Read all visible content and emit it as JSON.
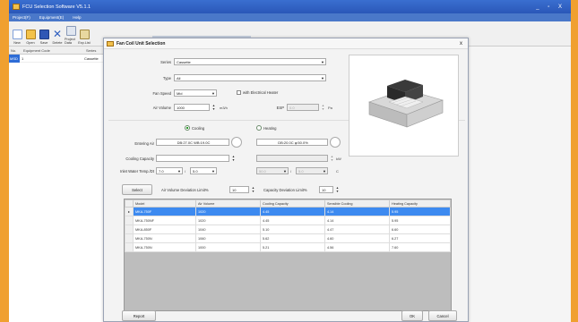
{
  "window": {
    "title": "FCU Selection Software V5.1.1",
    "controls": "_ ▫ X"
  },
  "menu": [
    "Project(F)",
    "Equipment(E)",
    "Help"
  ],
  "toolbar": [
    {
      "label": "New",
      "icon": "new-icon"
    },
    {
      "label": "Open",
      "icon": "open-icon"
    },
    {
      "label": "Save",
      "icon": "save-icon"
    },
    {
      "label": "Delete",
      "icon": "delete-icon"
    },
    {
      "label": "Project Data",
      "icon": "project-data-icon"
    },
    {
      "label": "Exp.List",
      "icon": "exp-list-icon"
    }
  ],
  "left_grid": {
    "columns": [
      "No.",
      "Equipment Code",
      "Series"
    ],
    "rows": [
      {
        "tag": "MSD",
        "no": "1",
        "series": "Cassette"
      }
    ]
  },
  "dialog": {
    "title": "Fan Coil Unit Selection",
    "close": "x",
    "series": {
      "label": "Series",
      "value": "Cassette"
    },
    "type": {
      "label": "Type",
      "value": "All"
    },
    "fan_speed": {
      "label": "Fan Speed",
      "value": "Mid"
    },
    "electrical_heater": "with Electrical Heater",
    "air_volume": {
      "label": "Air Volume",
      "value": "1000",
      "unit": "m3/h"
    },
    "esp": {
      "label": "ESP",
      "value": "0.0",
      "unit": "Pa"
    },
    "cooling_radio": "Cooling",
    "heating_radio": "Heating",
    "entering_air": {
      "label": "Entering Air",
      "cooling": "DB:27.0C WB:19.0C",
      "heating": "DB:20.0C φ:50.0%"
    },
    "cooling_capacity": {
      "label": "Cooling Capacity",
      "unit": "kW"
    },
    "inlet_water": {
      "label": "Inlet Water Temp./Dt",
      "cool_t": "7.0",
      "cool_dt": "5.0",
      "heat_t": "50.0",
      "heat_dt": "5.0",
      "sep": "/",
      "unit": "C"
    },
    "select_button": "Select",
    "air_volume_dev": {
      "label": "Air Volume Deviation Limit%",
      "value": "10"
    },
    "capacity_dev": {
      "label": "Capacity Deviation Limit%",
      "value": "10"
    },
    "table": {
      "columns": [
        "Model",
        "Air Volume",
        "Cooling Capacity",
        "Sensible Cooling",
        "Heating Capacity"
      ],
      "rows": [
        [
          "MKA-750F",
          "1020",
          "4.45",
          "4.14",
          "5.95"
        ],
        [
          "MKA-750NF",
          "1020",
          "4.45",
          "4.14",
          "5.95"
        ],
        [
          "MKA-850F",
          "1040",
          "5.10",
          "4.47",
          "6.60"
        ],
        [
          "MKA-750N",
          "1060",
          "5.62",
          "4.60",
          "6.27"
        ],
        [
          "MKA-750N",
          "1000",
          "5.21",
          "4.56",
          "7.60"
        ]
      ]
    },
    "report_button": "Report",
    "ok_button": "OK",
    "cancel_button": "Cancel"
  }
}
